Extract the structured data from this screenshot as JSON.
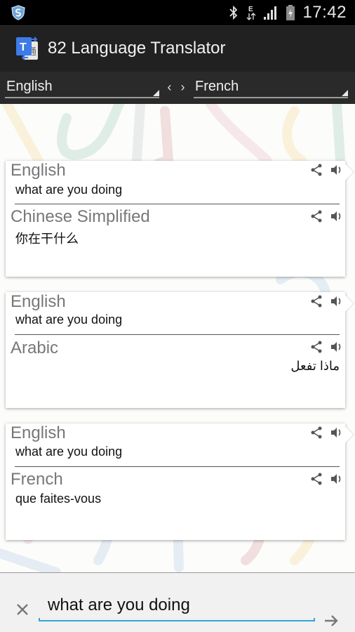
{
  "status_bar": {
    "time": "17:42",
    "icons": [
      "shield-security-icon",
      "bluetooth-icon",
      "edge-data-icon",
      "signal-icon",
      "battery-charging-icon"
    ],
    "network_type": "E"
  },
  "app": {
    "title": "82 Language Translator",
    "icon": "translator-app-icon"
  },
  "language_selector": {
    "source": "English",
    "target": "French",
    "swap_icon": "swap-arrows-icon",
    "swap_glyph": "‹ ›"
  },
  "translations": [
    {
      "source_lang": "English",
      "source_text": "what are you doing",
      "target_lang": "Chinese Simplified",
      "target_text": "你在干什么",
      "target_rtl": false
    },
    {
      "source_lang": "English",
      "source_text": "what are you doing",
      "target_lang": "Arabic",
      "target_text": "ماذا تفعل",
      "target_rtl": true
    },
    {
      "source_lang": "English",
      "source_text": "what are you doing",
      "target_lang": "French",
      "target_text": "que faites-vous",
      "target_rtl": false
    }
  ],
  "input": {
    "value": "what are you doing",
    "clear_icon": "close-icon",
    "send_icon": "arrow-right-icon"
  },
  "colors": {
    "accent": "#33a6d6",
    "actionbar": "#212121",
    "langbar": "#2a2a2a",
    "label_gray": "#777777"
  }
}
